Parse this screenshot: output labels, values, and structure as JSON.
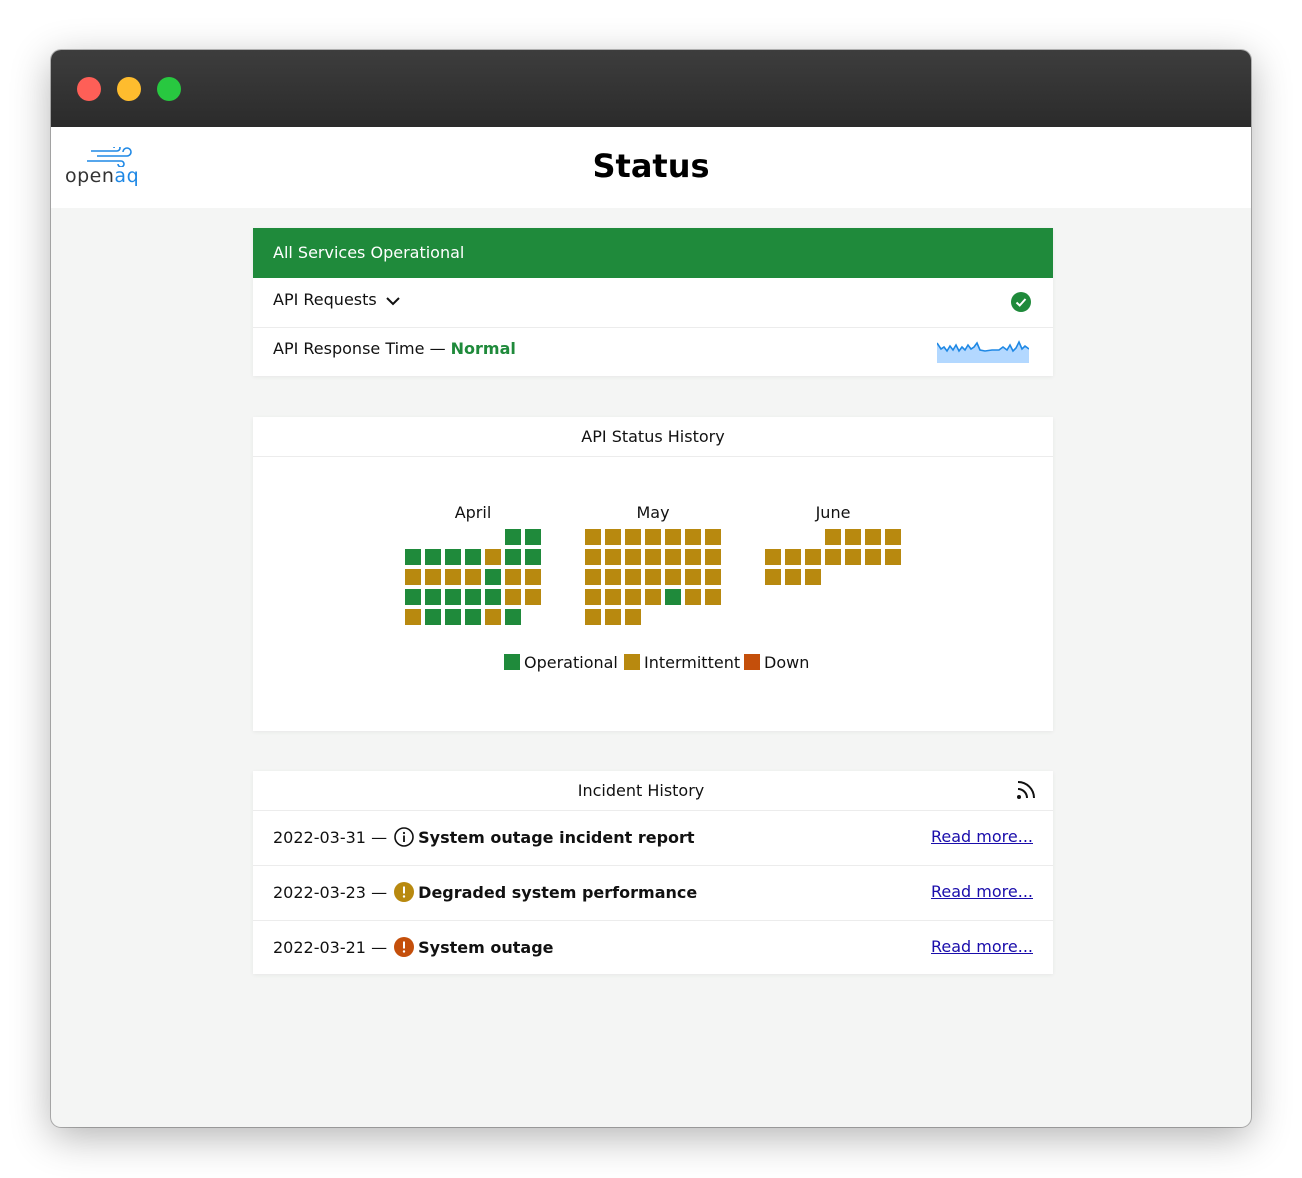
{
  "app": {
    "title": "Status",
    "logo_text_main": "open",
    "logo_text_accent": "aq"
  },
  "colors": {
    "operational": "#1f8a3b",
    "intermittent": "#b8890f",
    "down": "#c44f0b",
    "link": "#1a0dab"
  },
  "services": {
    "banner": "All Services Operational",
    "api_requests_label": "API Requests",
    "api_requests_status_icon": "check-circle-icon",
    "response_time_label": "API Response Time — ",
    "response_time_status": "Normal"
  },
  "status_history": {
    "title": "API Status History",
    "months": [
      {
        "name": "April",
        "lead": 5,
        "days": [
          "O",
          "O",
          "O",
          "O",
          "O",
          "O",
          "I",
          "O",
          "O",
          "I",
          "I",
          "I",
          "I",
          "O",
          "I",
          "I",
          "O",
          "O",
          "O",
          "O",
          "O",
          "I",
          "I",
          "I",
          "O",
          "O",
          "O",
          "I",
          "O"
        ]
      },
      {
        "name": "May",
        "lead": 0,
        "days": [
          "I",
          "I",
          "I",
          "I",
          "I",
          "I",
          "I",
          "I",
          "I",
          "I",
          "I",
          "I",
          "I",
          "I",
          "I",
          "I",
          "I",
          "I",
          "I",
          "I",
          "I",
          "I",
          "I",
          "I",
          "I",
          "O",
          "I",
          "I",
          "I",
          "I",
          "I"
        ]
      },
      {
        "name": "June",
        "lead": 3,
        "days": [
          "I",
          "I",
          "I",
          "I",
          "I",
          "I",
          "I",
          "I",
          "I",
          "I",
          "I",
          "I",
          "I",
          "I"
        ]
      }
    ],
    "legend": [
      {
        "key": "O",
        "label": "Operational"
      },
      {
        "key": "I",
        "label": "Intermittent"
      },
      {
        "key": "D",
        "label": "Down"
      }
    ]
  },
  "incidents": {
    "title": "Incident History",
    "feed_icon": "rss-icon",
    "items": [
      {
        "date": "2022-03-31 — ",
        "icon": "info-icon",
        "title": "System outage incident report",
        "link": "Read more..."
      },
      {
        "date": "2022-03-23 — ",
        "icon": "warning-icon",
        "title": "Degraded system performance",
        "link": "Read more..."
      },
      {
        "date": "2022-03-21 — ",
        "icon": "error-icon",
        "title": "System outage",
        "link": "Read more..."
      }
    ]
  }
}
